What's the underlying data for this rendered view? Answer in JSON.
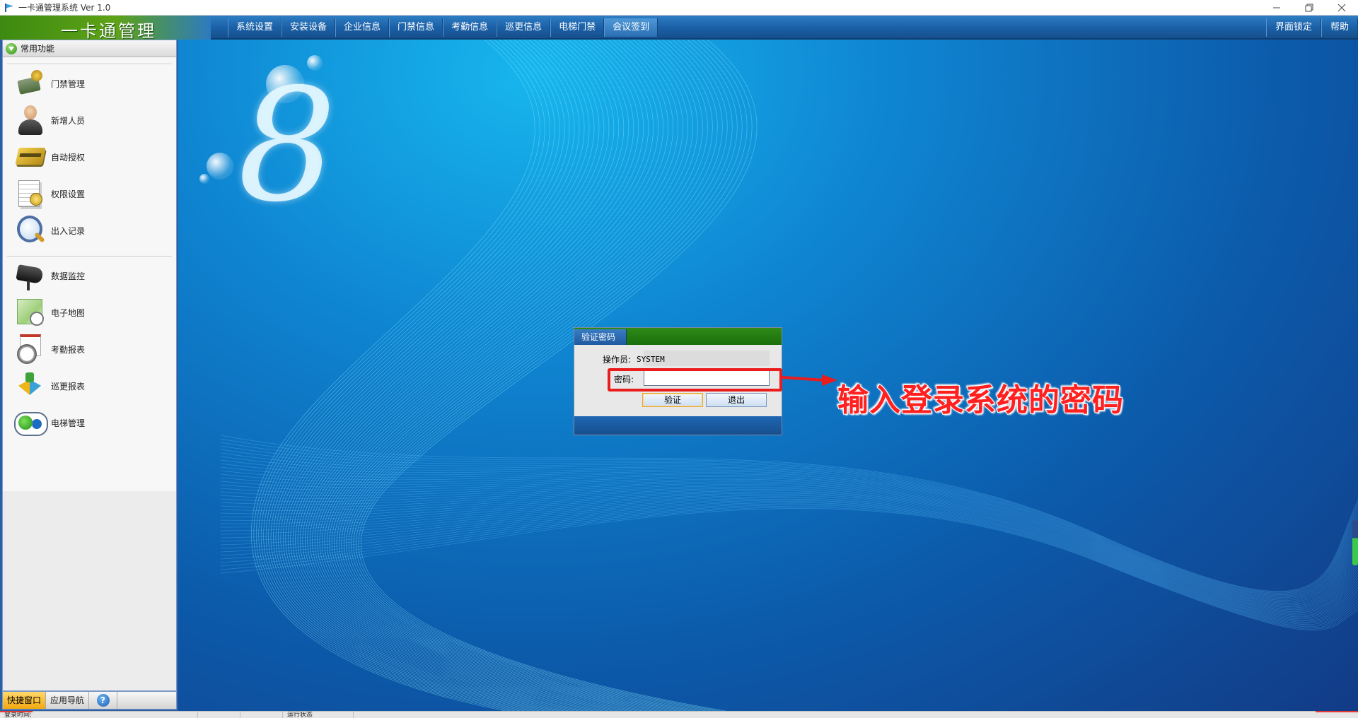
{
  "window": {
    "title": "一卡通管理系统  Ver 1.0",
    "controls": [
      "minimize",
      "restore",
      "close"
    ]
  },
  "brand": {
    "title": "一卡通管理"
  },
  "menu": {
    "items": [
      "系统设置",
      "安装设备",
      "企业信息",
      "门禁信息",
      "考勤信息",
      "巡更信息",
      "电梯门禁",
      "会议签到"
    ],
    "right_items": [
      "界面锁定",
      "帮助"
    ]
  },
  "sidebar": {
    "title": "常用功能",
    "group1": [
      {
        "label": "门禁管理",
        "icon": "door-access-icon"
      },
      {
        "label": "新增人员",
        "icon": "person-icon"
      },
      {
        "label": "自动授权",
        "icon": "card-icon"
      },
      {
        "label": "权限设置",
        "icon": "document-icon"
      },
      {
        "label": "出入记录",
        "icon": "magnifier-icon"
      }
    ],
    "group2": [
      {
        "label": "数据监控",
        "icon": "camera-icon"
      },
      {
        "label": "电子地图",
        "icon": "map-icon"
      },
      {
        "label": "考勤报表",
        "icon": "clock-icon"
      },
      {
        "label": "巡更报表",
        "icon": "puzzle-icon"
      },
      {
        "label": "电梯管理",
        "icon": "elevator-icon"
      }
    ],
    "tabs": {
      "quick": "快捷窗口",
      "nav": "应用导航",
      "help": "?"
    }
  },
  "dialog": {
    "tab": "验证密码",
    "operator_label": "操作员:",
    "operator_value": "SYSTEM",
    "password_label": "密码:",
    "password_value": "",
    "verify_button": "验证",
    "exit_button": "退出"
  },
  "annotation": {
    "text": "输入登录系统的密码",
    "color": "#ff2020"
  },
  "statusbar": {
    "cells": [
      "登录时间:",
      "",
      "",
      "运行状态"
    ]
  },
  "colors": {
    "menu_blue": "#1a5fa6",
    "brand_green": "#5ea316",
    "background_blue": "#0c5aaa",
    "highlight_red": "#ea1c1c"
  }
}
